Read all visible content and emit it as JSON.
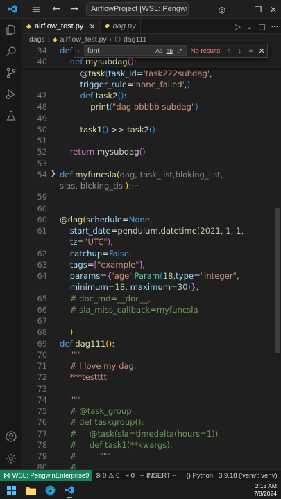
{
  "titlebar": {
    "command_center": "AirflowProject [WSL: PengwinEnterpri"
  },
  "tabs": [
    {
      "label": "airflow_test.py"
    },
    {
      "label": "dag.py"
    }
  ],
  "breadcrumb": [
    "dags",
    "airflow_test.py",
    "dag111"
  ],
  "find": {
    "query": "font",
    "case_label": "Aa",
    "word_label": "ab",
    "regex_label": ".*",
    "status": "No results"
  },
  "editor": {
    "lines": [
      {
        "n": "34",
        "segs": [
          [
            "kw",
            "def"
          ]
        ]
      },
      {
        "n": "40",
        "segs": [
          [
            "",
            "    "
          ],
          [
            "kw",
            "def"
          ],
          [
            "",
            " "
          ],
          [
            "fn",
            "mysubdag"
          ],
          [
            "br2",
            "()"
          ],
          [
            "",
            ":"
          ]
        ]
      },
      {
        "n": "",
        "segs": [
          [
            "",
            "        @"
          ],
          [
            "fn",
            "task"
          ],
          [
            "br3",
            "("
          ],
          [
            "par",
            "task_id"
          ],
          [
            "",
            "="
          ],
          [
            "str",
            "'task222subdag'"
          ],
          [
            "",
            ","
          ]
        ]
      },
      {
        "n": "",
        "segs": [
          [
            "",
            "        "
          ],
          [
            "par",
            "trigger_rule"
          ],
          [
            "",
            "="
          ],
          [
            "str",
            "'none_failed'"
          ],
          [
            "",
            ","
          ],
          [
            "br3",
            ")"
          ]
        ]
      },
      {
        "n": "47",
        "segs": [
          [
            "",
            "        "
          ],
          [
            "kw",
            "def"
          ],
          [
            "",
            " "
          ],
          [
            "fn",
            "task2"
          ],
          [
            "br3",
            "()"
          ],
          [
            "",
            ":"
          ]
        ]
      },
      {
        "n": "48",
        "segs": [
          [
            "",
            "            "
          ],
          [
            "fn",
            "print"
          ],
          [
            "br3",
            "("
          ],
          [
            "str",
            "\"dag bbbbb subdag\""
          ],
          [
            "br3",
            ")"
          ]
        ]
      },
      {
        "n": "49",
        "segs": []
      },
      {
        "n": "50",
        "segs": [
          [
            "",
            "        "
          ],
          [
            "fn",
            "task1"
          ],
          [
            "br3",
            "()"
          ],
          [
            "",
            " >> "
          ],
          [
            "fn",
            "task2"
          ],
          [
            "br3",
            "()"
          ]
        ]
      },
      {
        "n": "51",
        "segs": []
      },
      {
        "n": "52",
        "segs": [
          [
            "",
            "    "
          ],
          [
            "ctl",
            "return"
          ],
          [
            "",
            " mysubdag"
          ],
          [
            "br2",
            "()"
          ]
        ]
      },
      {
        "n": "53",
        "segs": []
      },
      {
        "n": "54",
        "segs": [
          [
            "kw",
            "def"
          ],
          [
            "",
            " "
          ],
          [
            "fn",
            "myfuncsla"
          ],
          [
            "br1",
            "("
          ],
          [
            "dim",
            "dag, task_list,bloking_list,"
          ]
        ]
      },
      {
        "n": "",
        "segs": [
          [
            "dim",
            "slas, blcking_tis "
          ],
          [
            "br1",
            ")"
          ],
          [
            "dim",
            ":"
          ],
          [
            "dim",
            "···"
          ]
        ]
      },
      {
        "n": "59",
        "segs": []
      },
      {
        "n": "60",
        "segs": []
      },
      {
        "n": "60",
        "segs": [
          [
            "",
            "@"
          ],
          [
            "fn",
            "dag"
          ],
          [
            "br1",
            "("
          ],
          [
            "par",
            "schedule"
          ],
          [
            "",
            "="
          ],
          [
            "kw",
            "None"
          ],
          [
            "",
            ","
          ]
        ]
      },
      {
        "n": "61",
        "segs": [
          [
            "",
            "    "
          ],
          [
            "par",
            "start_date"
          ],
          [
            "",
            "=pendulum."
          ],
          [
            "fn",
            "datetime"
          ],
          [
            "br2",
            "("
          ],
          [
            "num",
            "2021"
          ],
          [
            "",
            ", "
          ],
          [
            "num",
            "1"
          ],
          [
            "",
            ", "
          ],
          [
            "num",
            "1"
          ],
          [
            "",
            ","
          ]
        ]
      },
      {
        "n": "",
        "segs": [
          [
            "",
            "    "
          ],
          [
            "par",
            "tz"
          ],
          [
            "",
            "="
          ],
          [
            "str",
            "\"UTC\""
          ],
          [
            "br2",
            ")"
          ],
          [
            "",
            ","
          ]
        ]
      },
      {
        "n": "62",
        "segs": [
          [
            "",
            "    "
          ],
          [
            "par",
            "catchup"
          ],
          [
            "",
            "="
          ],
          [
            "kw",
            "False"
          ],
          [
            "",
            ","
          ]
        ]
      },
      {
        "n": "63",
        "segs": [
          [
            "",
            "    "
          ],
          [
            "par",
            "tags"
          ],
          [
            "",
            "="
          ],
          [
            "br2",
            "["
          ],
          [
            "str",
            "\"example\""
          ],
          [
            "br2",
            "]"
          ],
          [
            "",
            ","
          ]
        ]
      },
      {
        "n": "64",
        "segs": [
          [
            "",
            "    "
          ],
          [
            "par",
            "params"
          ],
          [
            "",
            "="
          ],
          [
            "br2",
            "{"
          ],
          [
            "str",
            "'age'"
          ],
          [
            "",
            ":"
          ],
          [
            "cls",
            "Param"
          ],
          [
            "br3",
            "("
          ],
          [
            "num",
            "18"
          ],
          [
            "",
            ","
          ],
          [
            "par",
            "type"
          ],
          [
            "",
            "="
          ],
          [
            "str",
            "\"integer\""
          ],
          [
            "",
            ","
          ]
        ]
      },
      {
        "n": "",
        "segs": [
          [
            "",
            "    "
          ],
          [
            "par",
            "minimum"
          ],
          [
            "",
            "="
          ],
          [
            "num",
            "18"
          ],
          [
            "",
            ", "
          ],
          [
            "par",
            "maximum"
          ],
          [
            "",
            "="
          ],
          [
            "num",
            "30"
          ],
          [
            "br3",
            ")"
          ],
          [
            "br2",
            "}"
          ],
          [
            "",
            ","
          ]
        ]
      },
      {
        "n": "65",
        "segs": [
          [
            "",
            "    "
          ],
          [
            "cmt",
            "# doc_md=__doc__,"
          ]
        ]
      },
      {
        "n": "66",
        "segs": [
          [
            "",
            "    "
          ],
          [
            "cmt",
            "# sla_miss_callback=myfuncsla"
          ]
        ]
      },
      {
        "n": "67",
        "segs": []
      },
      {
        "n": "68",
        "segs": [
          [
            "",
            "    "
          ],
          [
            "br1",
            ")"
          ]
        ]
      },
      {
        "n": "69",
        "segs": [
          [
            "kw",
            "def"
          ],
          [
            "",
            " "
          ],
          [
            "fn",
            "dag111"
          ],
          [
            "br1",
            "()"
          ],
          [
            "",
            ":"
          ]
        ]
      },
      {
        "n": "70",
        "segs": [
          [
            "",
            "    "
          ],
          [
            "str",
            "\"\"\""
          ]
        ]
      },
      {
        "n": "71",
        "segs": [
          [
            "",
            "    "
          ],
          [
            "str",
            "# I love my dag."
          ]
        ]
      },
      {
        "n": "72",
        "segs": [
          [
            "",
            "    "
          ],
          [
            "str",
            "***testttt"
          ]
        ]
      },
      {
        "n": "73",
        "segs": []
      },
      {
        "n": "74",
        "segs": [
          [
            "",
            "    "
          ],
          [
            "str",
            "\"\"\""
          ]
        ]
      },
      {
        "n": "75",
        "segs": [
          [
            "",
            "    "
          ],
          [
            "cmt",
            "# @task_group"
          ]
        ]
      },
      {
        "n": "76",
        "segs": [
          [
            "",
            "    "
          ],
          [
            "cmt",
            "# def taskgroup():"
          ]
        ]
      },
      {
        "n": "77",
        "segs": [
          [
            "",
            "    "
          ],
          [
            "cmt",
            "#     @task(sla=timedelta(hours=1))"
          ]
        ]
      },
      {
        "n": "78",
        "segs": [
          [
            "",
            "    "
          ],
          [
            "cmt",
            "#     def task1(**kwargs):"
          ]
        ]
      },
      {
        "n": "79",
        "segs": [
          [
            "",
            "    "
          ],
          [
            "cmt",
            "#         \"\"\""
          ]
        ]
      },
      {
        "n": "80",
        "segs": [
          [
            "",
            "    "
          ],
          [
            "cmt",
            "#"
          ]
        ]
      }
    ]
  },
  "statusbar": {
    "remote": "WSL: PengwinEnterprise9",
    "errors": "0",
    "warnings": "0",
    "ports": "0",
    "mode": "-- INSERT --",
    "language": "Python",
    "interpreter": "3.9.18 ('venv': venv)"
  },
  "taskbar": {
    "time": "2:13 AM",
    "date": "7/8/2024"
  }
}
